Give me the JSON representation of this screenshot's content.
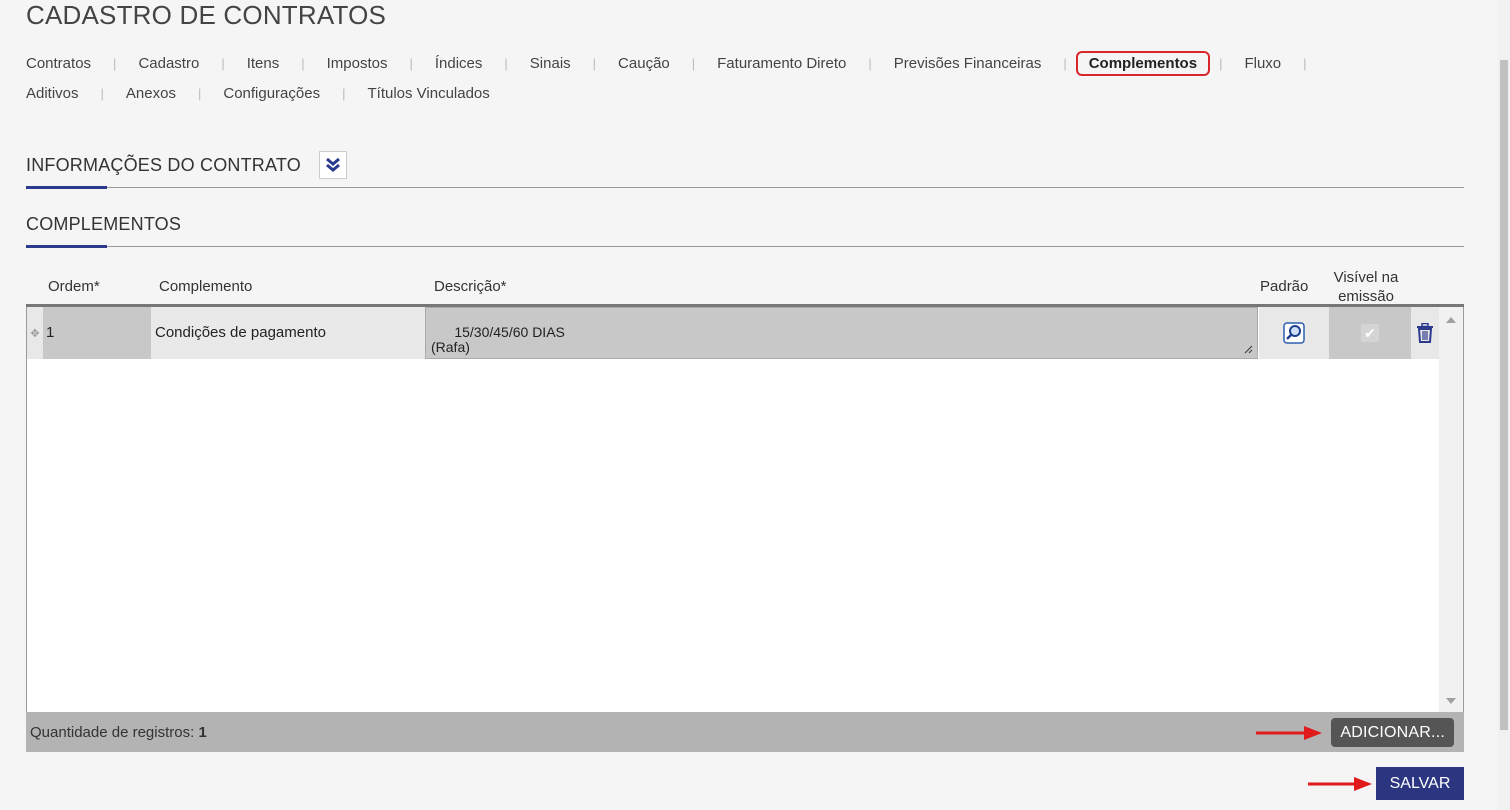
{
  "page": {
    "title": "CADASTRO DE CONTRATOS"
  },
  "tabs_row1": [
    {
      "label": "Contratos"
    },
    {
      "label": "Cadastro"
    },
    {
      "label": "Itens"
    },
    {
      "label": "Impostos"
    },
    {
      "label": "Índices"
    },
    {
      "label": "Sinais"
    },
    {
      "label": "Caução"
    },
    {
      "label": "Faturamento Direto"
    },
    {
      "label": "Previsões Financeiras"
    },
    {
      "label": "Complementos",
      "active": true
    },
    {
      "label": "Fluxo"
    }
  ],
  "tabs_row2": [
    {
      "label": "Aditivos"
    },
    {
      "label": "Anexos"
    },
    {
      "label": "Configurações"
    },
    {
      "label": "Títulos Vinculados"
    }
  ],
  "sections": {
    "info": {
      "title": "INFORMAÇÕES DO CONTRATO"
    },
    "complementos": {
      "title": "COMPLEMENTOS"
    }
  },
  "grid": {
    "columns": {
      "ordem": "Ordem*",
      "complemento": "Complemento",
      "descricao": "Descrição*",
      "padrao": "Padrão",
      "visivel_line1": "Visível na",
      "visivel_line2": "emissão"
    },
    "rows": [
      {
        "ordem": "1",
        "complemento": "Condições de pagamento",
        "descricao": "15/30/45/60 DIAS\n(Rafa)",
        "visivel": true
      }
    ],
    "footer": {
      "records_label": "Quantidade de registros:",
      "records_count": "1",
      "add_button": "ADICIONAR..."
    }
  },
  "actions": {
    "save_button": "SALVAR"
  },
  "colors": {
    "accent": "#2b3a8c",
    "highlight_border": "#d9262b",
    "annotation_arrow": "#e11b1b",
    "save_button_bg": "#2b3580",
    "add_button_bg": "#555555"
  }
}
